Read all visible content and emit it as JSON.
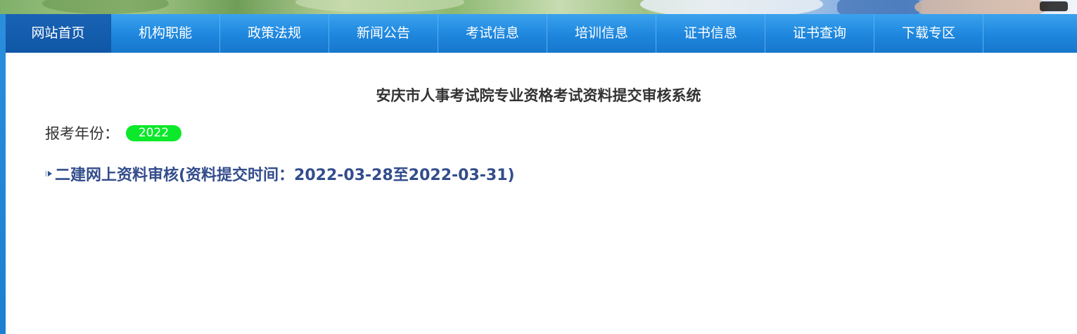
{
  "nav": {
    "items": [
      {
        "label": "网站首页"
      },
      {
        "label": "机构职能"
      },
      {
        "label": "政策法规"
      },
      {
        "label": "新闻公告"
      },
      {
        "label": "考试信息"
      },
      {
        "label": "培训信息"
      },
      {
        "label": "证书信息"
      },
      {
        "label": "证书查询"
      },
      {
        "label": "下载专区"
      }
    ],
    "active_index": 0
  },
  "main": {
    "title": "安庆市人事考试院专业资格考试资料提交审核系统",
    "year_label": "报考年份：",
    "year_value": "2022",
    "exam_link": "二建网上资料审核(资料提交时间：2022-03-28至2022-03-31)"
  },
  "colors": {
    "nav_bg": "#1e86dd",
    "nav_active": "#0f56a6",
    "year_badge": "#0ce82a",
    "link": "#334d8c"
  }
}
